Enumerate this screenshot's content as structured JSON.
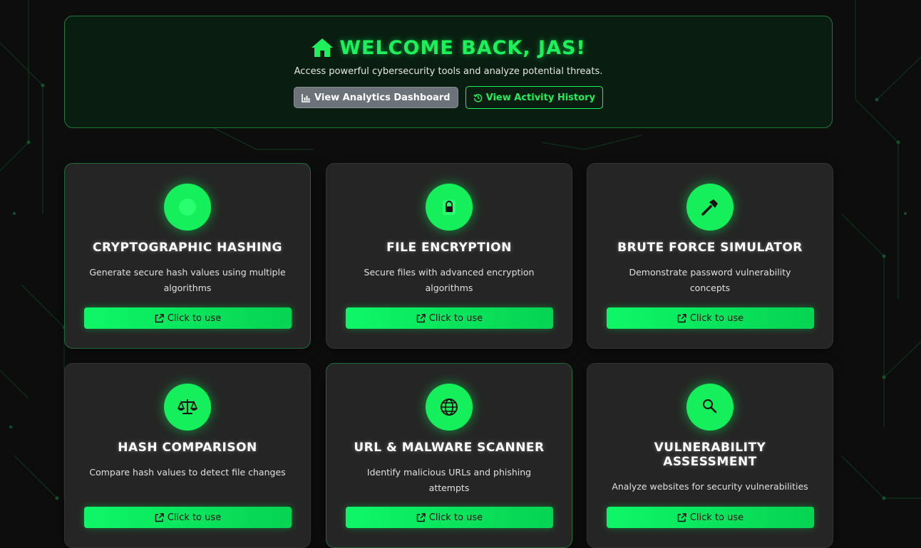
{
  "welcome": {
    "title": "WELCOME BACK, JAS!",
    "subtitle": "Access powerful cybersecurity tools and analyze potential threats.",
    "analytics_label": "View Analytics Dashboard",
    "history_label": "View Activity History",
    "icon": "home-icon"
  },
  "tools": [
    {
      "title": "CRYPTOGRAPHIC HASHING",
      "description": "Generate secure hash values using multiple algorithms",
      "action": "Click to use",
      "icon": "hash-icon"
    },
    {
      "title": "FILE ENCRYPTION",
      "description": "Secure files with advanced encryption algorithms",
      "action": "Click to use",
      "icon": "lock-icon"
    },
    {
      "title": "BRUTE FORCE SIMULATOR",
      "description": "Demonstrate password vulnerability concepts",
      "action": "Click to use",
      "icon": "hammer-icon"
    },
    {
      "title": "HASH COMPARISON",
      "description": "Compare hash values to detect file changes",
      "action": "Click to use",
      "icon": "scale-icon"
    },
    {
      "title": "URL & MALWARE SCANNER",
      "description": "Identify malicious URLs and phishing attempts",
      "action": "Click to use",
      "icon": "globe-icon"
    },
    {
      "title": "VULNERABILITY ASSESSMENT",
      "description": "Analyze websites for security vulnerabilities",
      "action": "Click to use",
      "icon": "search-icon"
    }
  ],
  "colors": {
    "accent": "#14ef5b",
    "background": "#0c0d0c",
    "card": "#252525"
  }
}
